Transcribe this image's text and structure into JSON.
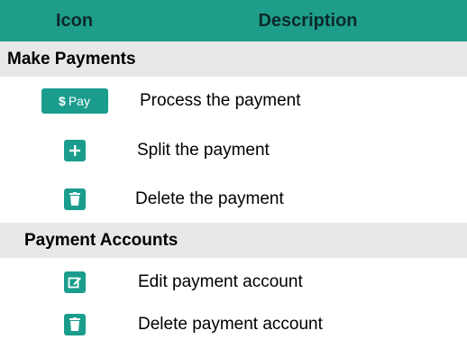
{
  "header": {
    "icon_col": "Icon",
    "desc_col": "Description"
  },
  "sections": {
    "make_payments": {
      "title": "Make Payments",
      "rows": {
        "pay": {
          "button_dollar": "$",
          "button_label": "Pay",
          "description": "Process the payment",
          "icon": "pay-button"
        },
        "split": {
          "description": "Split the payment",
          "icon": "plus-icon"
        },
        "delete": {
          "description": "Delete the payment",
          "icon": "trash-icon"
        }
      }
    },
    "payment_accounts": {
      "title": "Payment Accounts",
      "rows": {
        "edit": {
          "description": "Edit payment account",
          "icon": "edit-icon"
        },
        "delete": {
          "description": "Delete payment account",
          "icon": "trash-icon"
        }
      }
    }
  },
  "colors": {
    "header_bg": "#1f9d8b",
    "section_bg": "#e8e8e8",
    "icon_bg": "#1a9d8c"
  }
}
